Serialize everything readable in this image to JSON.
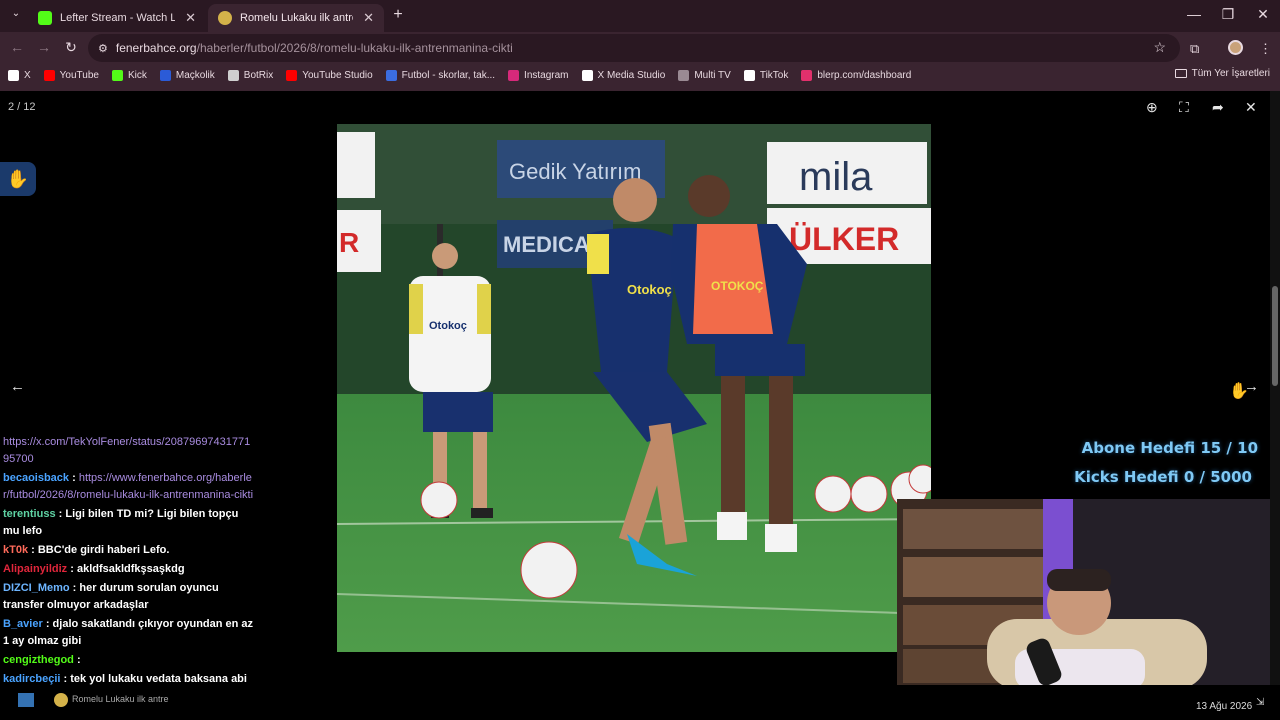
{
  "browser": {
    "tabs": [
      {
        "title": "Lefter Stream - Watch Live on K",
        "favicon_color": "#53fc18",
        "active": false
      },
      {
        "title": "Romelu Lukaku ilk antrenman",
        "favicon_color": "#d4b24a",
        "active": true
      }
    ],
    "new_tab_symbol": "+",
    "window": {
      "minimize": "—",
      "maximize": "❐",
      "close": "✕"
    },
    "url_host": "fenerbahce.org",
    "url_path": "/haberler/futbol/2026/8/romelu-lukaku-ilk-antrenmanina-cikti",
    "bookmarks": [
      {
        "label": "X",
        "color": "#ffffff"
      },
      {
        "label": "YouTube",
        "color": "#ff0000"
      },
      {
        "label": "Kick",
        "color": "#53fc18"
      },
      {
        "label": "Maçkolik",
        "color": "#2b5bd7"
      },
      {
        "label": "BotRix",
        "color": "#cfcfcf"
      },
      {
        "label": "YouTube Studio",
        "color": "#ff0000"
      },
      {
        "label": "Futbol - skorlar, tak...",
        "color": "#3b6de0"
      },
      {
        "label": "Instagram",
        "color": "#d6297a"
      },
      {
        "label": "X Media Studio",
        "color": "#ffffff"
      },
      {
        "label": "Multi TV",
        "color": "#9a8a93"
      },
      {
        "label": "TikTok",
        "color": "#ffffff"
      },
      {
        "label": "blerp.com/dashboard",
        "color": "#e2306c"
      }
    ],
    "all_bookmarks": "Tüm Yer İşaretleri"
  },
  "viewer": {
    "counter": "2 / 12",
    "photo_labels": {
      "banner1": "Gedik Yatırım",
      "banner2": "MEDICA",
      "banner3": "mila",
      "banner4": "ÜLKER",
      "banner5": "R",
      "shirt_sponsor": "Otokoç"
    }
  },
  "chat": [
    {
      "user": "",
      "user_color": "#ffffff",
      "text": "https://x.com/TekYolFener/status/2087969743177195700",
      "link": true
    },
    {
      "user": "becaoisback",
      "user_color": "#4aa3ff",
      "text": "https://www.fenerbahce.org/haberler/futbol/2026/8/romelu-lukaku-ilk-antrenmanina-cikti",
      "link": true
    },
    {
      "user": "terentiuss",
      "user_color": "#5fd3a4",
      "text": "Ligi bilen TD mi? Ligi bilen topçu mu lefo",
      "link": false
    },
    {
      "user": "kT0k",
      "user_color": "#ff6a5a",
      "text": "BBC'de girdi haberi Lefo.",
      "link": false
    },
    {
      "user": "Alipainyildiz",
      "user_color": "#e0263b",
      "text": "akldfsakldfkşsaşkdg",
      "link": false
    },
    {
      "user": "DIZCI_Memo",
      "user_color": "#6db5ff",
      "text": "her durum sorulan oyuncu transfer olmuyor arkadaşlar",
      "link": false
    },
    {
      "user": "B_avier",
      "user_color": "#4aa3ff",
      "text": "djalo sakatlandı çıkıyor oyundan en az 1 ay olmaz gibi",
      "link": false
    },
    {
      "user": "cengizthegod",
      "user_color": "#53fc18",
      "text": "",
      "link": false
    },
    {
      "user": "kadircbeçii",
      "user_color": "#4aa3ff",
      "text": "tek yol lukaku vedata baksana abi",
      "link": false
    }
  ],
  "overlay": {
    "sub_goal": "Abone Hedefi 15 / 10",
    "kicks_goal": "Kicks Hedefi 0 / 5000"
  },
  "taskbar": {
    "pinned": "Romelu Lukaku ilk antre",
    "date": "13 Ağu 2026"
  }
}
